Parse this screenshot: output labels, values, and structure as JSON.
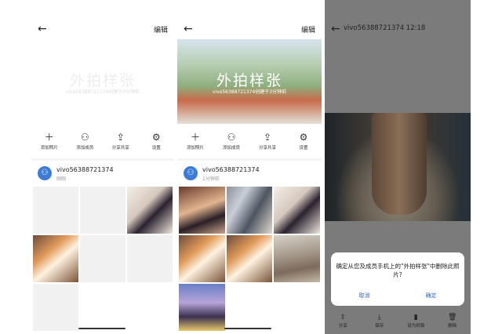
{
  "panels": [
    {
      "edit_label": "编辑",
      "cover_title": "外拍样张",
      "cover_subtitle": "vivo56388721374创建于3分钟前",
      "actions": [
        "添加照片",
        "添加成员",
        "分享共享",
        "设置"
      ],
      "user": {
        "name": "vivo56388721374",
        "time": "刚刚",
        "avatar_icon": "user-icon"
      }
    },
    {
      "edit_label": "编辑",
      "cover_title": "外拍样张",
      "cover_subtitle": "vivo56388721374创建于3分钟前",
      "actions": [
        "添加照片",
        "添加成员",
        "分享共享",
        "设置"
      ],
      "user": {
        "name": "vivo56388721374",
        "time": "1分钟前",
        "avatar_icon": "user-icon"
      }
    },
    {
      "title": "vivo56388721374 12:18",
      "dialog": {
        "message": "确定从您及成员手机上的\"外拍样张\"中删除此照片?",
        "cancel": "取消",
        "ok": "确定"
      },
      "bottom_bar": [
        "分享",
        "保存",
        "设为封面",
        "删除"
      ]
    }
  ],
  "colors": {
    "accent": "#2f68d6",
    "avatar": "#3d7bd9"
  }
}
